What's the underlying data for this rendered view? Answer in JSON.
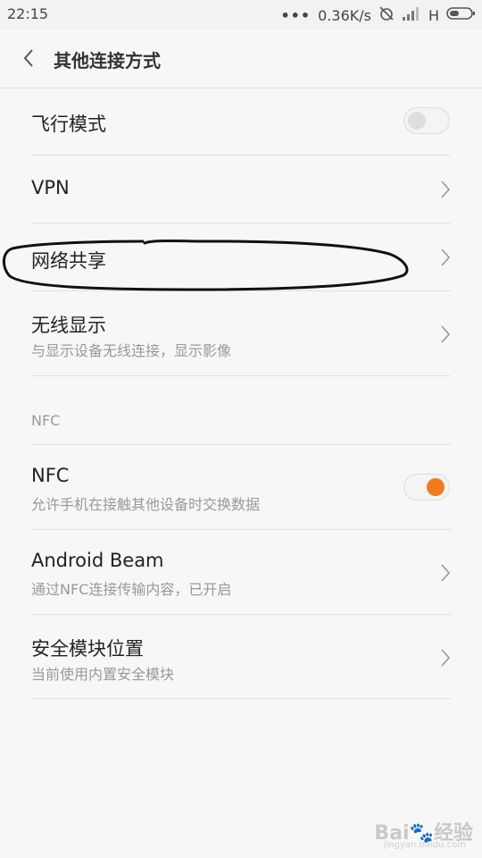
{
  "status_bar": {
    "time": "22:15",
    "dots": "•••",
    "network_speed": "0.36K/s",
    "network_type": "H",
    "icons": [
      "alarm-off-icon",
      "signal-icon",
      "battery-icon"
    ]
  },
  "header": {
    "back_icon": "chevron-left-icon",
    "title": "其他连接方式"
  },
  "settings": {
    "airplane": {
      "title": "飞行模式",
      "toggle_state": "off"
    },
    "vpn": {
      "title": "VPN"
    },
    "tethering": {
      "title": "网络共享"
    },
    "wireless_display": {
      "title": "无线显示",
      "subtitle": "与显示设备无线连接，显示影像"
    },
    "nfc_section": {
      "header": "NFC"
    },
    "nfc": {
      "title": "NFC",
      "subtitle": "允许手机在接触其他设备时交换数据",
      "toggle_state": "on"
    },
    "android_beam": {
      "title": "Android Beam",
      "subtitle": "通过NFC连接传输内容，已开启"
    },
    "secure_element": {
      "title": "安全模块位置",
      "subtitle": "当前使用内置安全模块"
    }
  },
  "watermark": {
    "text": "Bai",
    "text2": "经验",
    "url": "jingyan.baidu.com"
  },
  "colors": {
    "accent": "#f47a20",
    "background": "#f7f7f7",
    "divider": "#e0e0e0"
  }
}
